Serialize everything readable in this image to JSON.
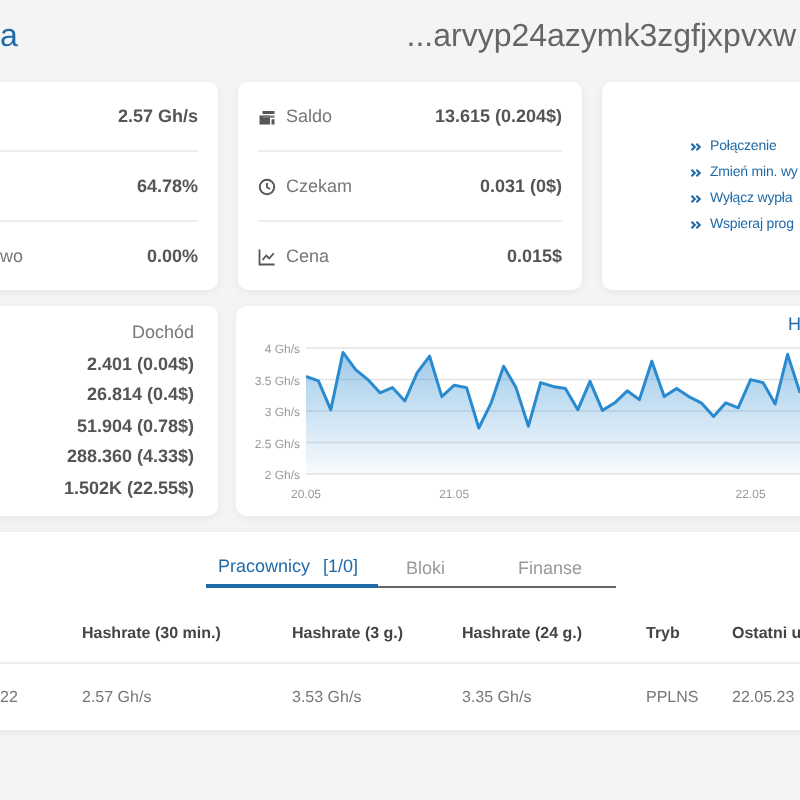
{
  "header": {
    "title": "a",
    "address": "...arvyp24azymk3zgfjxpvxw"
  },
  "stats": [
    {
      "value": "2.57 Gh/s"
    },
    {
      "value": "64.78%"
    },
    {
      "label": "wo",
      "value": "0.00%"
    }
  ],
  "wallet": [
    {
      "kind": "balance",
      "label": "Saldo",
      "value": "13.615 (0.204$)"
    },
    {
      "kind": "pending",
      "label": "Czekam",
      "value": "0.031 (0$)"
    },
    {
      "kind": "price",
      "label": "Cena",
      "value": "0.015$"
    }
  ],
  "links": [
    "Połączenie",
    "Zmień min. wy",
    "Wyłącz wypła",
    "Wspieraj prog"
  ],
  "income": {
    "heading": "Dochód",
    "values": [
      "2.401 (0.04$)",
      "26.814 (0.4$)",
      "51.904 (0.78$)",
      "288.360 (4.33$)",
      "1.502K (22.55$)"
    ]
  },
  "chart": {
    "chart_data": {
      "type": "area",
      "title": "H",
      "categories": [
        "20.05",
        null,
        null,
        null,
        null,
        null,
        null,
        null,
        null,
        null,
        null,
        null,
        "21.05",
        null,
        null,
        null,
        null,
        null,
        null,
        null,
        null,
        null,
        null,
        null,
        null,
        null,
        null,
        null,
        null,
        null,
        null,
        null,
        null,
        null,
        null,
        null,
        "22.05",
        null,
        null,
        null,
        null
      ],
      "series": [
        {
          "color": "#2a8ad0",
          "values": [
            3.55,
            3.48,
            3.02,
            3.93,
            3.66,
            3.5,
            3.29,
            3.37,
            3.16,
            3.61,
            3.87,
            3.23,
            3.41,
            3.37,
            2.73,
            3.13,
            3.71,
            3.37,
            2.76,
            3.45,
            3.39,
            3.36,
            3.02,
            3.47,
            3.01,
            3.13,
            3.32,
            3.18,
            3.79,
            3.23,
            3.36,
            3.23,
            3.13,
            2.91,
            3.13,
            3.05,
            3.5,
            3.45,
            3.11,
            3.9,
            3.29
          ]
        }
      ],
      "ylim": [
        2,
        4
      ],
      "grid": true,
      "yticks": [
        {
          "value": 2,
          "label": "2 Gh/s"
        },
        {
          "value": 2.5,
          "label": "2.5 Gh/s"
        },
        {
          "value": 3,
          "label": "3 Gh/s"
        },
        {
          "value": 3.5,
          "label": "3.5 Gh/s"
        },
        {
          "value": 4,
          "label": "4 Gh/s"
        }
      ]
    }
  },
  "tabs": [
    {
      "label": "Pracownicy [1/0]",
      "selected": true
    },
    {
      "label": "Bloki",
      "selected": false
    },
    {
      "label": "Finanse",
      "selected": false
    }
  ],
  "table": {
    "columns": [
      "",
      "Hashrate (30 min.)",
      "Hashrate (3 g.)",
      "Hashrate (24 g.)",
      "Tryb",
      "Ostatni u"
    ],
    "rows": [
      [
        "22",
        "2.57 Gh/s",
        "3.53 Gh/s",
        "3.35 Gh/s",
        "PPLNS",
        "22.05.23"
      ]
    ]
  }
}
